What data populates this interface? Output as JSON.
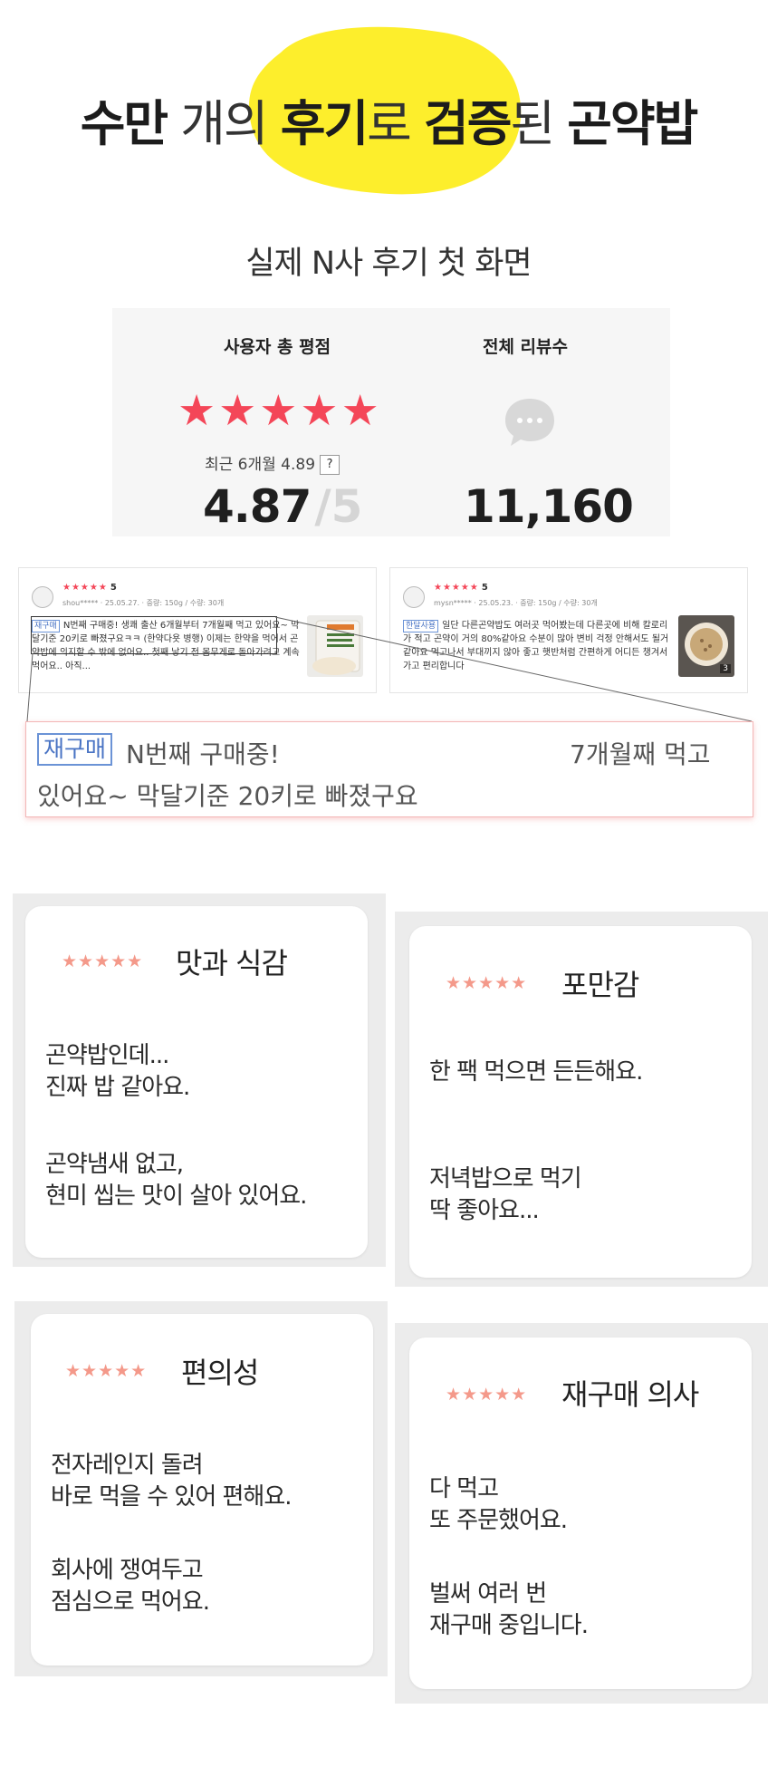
{
  "headline": {
    "part1": "수만",
    "part2": " 개의 ",
    "part3": "후기",
    "part4": "로 ",
    "part5": "검증",
    "part6": "된 ",
    "part7": "곤약밥"
  },
  "subtitle": "실제 N사 후기 첫 화면",
  "rating": {
    "title_left": "사용자 총 평점",
    "title_right": "전체 리뷰수",
    "stars": "★★★★★",
    "recent_label": "최근 6개월 4.89",
    "help_mark": "?",
    "score": "4.87",
    "score_max": "/5",
    "review_count": "11,160"
  },
  "reviews": [
    {
      "stars": "★★★★★",
      "rating": "5",
      "meta": "shou*****  · 25.05.27. · 중량: 150g / 수량: 30개",
      "tag": "재구매",
      "text": "N번째 구매중! 생쾌 출산 6개월부터 7개월째 먹고 있어요~ 막달기준 20키로 빠졌구요ㅋㅋ (한약다욧 병행) 이제는 한약을 먹어서 곤약밥에 의지할 수 밖에 없어요.. 첫째 낳기 전 몸무게로 돌아가려고 계속 먹어요.. 아직...",
      "photo_count": ""
    },
    {
      "stars": "★★★★★",
      "rating": "5",
      "meta": "mysn*****  · 25.05.23. · 중량: 150g / 수량: 30개",
      "tag": "한달사용",
      "text": "일단 다른곤약밥도 여러곳 먹어봤는데 다른곳에 비해 칼로리가 적고 곤약이 거의 80%같아요 수분이 많아 변비 걱정 안해서도 될거같아요 먹고나서 부대끼지 않아 좋고 햇반처럼 간편하게 어디든 챙겨서 가고 편리합니다",
      "photo_count": "3"
    }
  ],
  "zoom": {
    "tag": "재구매",
    "line1a": "N번째 구매중!",
    "line1b": "7개월째 먹고",
    "line2": "있어요~ 막달기준 20키로 빠졌구요"
  },
  "features": [
    {
      "stars": "★★★★★",
      "title": "맛과 식감",
      "p1a": "곤약밥인데...",
      "p1b": "진짜 밥 같아요.",
      "p2a": "곤약냄새 없고,",
      "p2b": "현미 씹는 맛이 살아 있어요."
    },
    {
      "stars": "★★★★★",
      "title": "포만감",
      "p1a": "한 팩 먹으면 든든해요.",
      "p1b": "",
      "p2a": "저녁밥으로 먹기",
      "p2b": "딱 좋아요..."
    },
    {
      "stars": "★★★★★",
      "title": "편의성",
      "p1a": "전자레인지 돌려",
      "p1b": "바로 먹을 수 있어 편해요.",
      "p2a": "회사에 쟁여두고",
      "p2b": "점심으로 먹어요."
    },
    {
      "stars": "★★★★★",
      "title": "재구매 의사",
      "p1a": "다 먹고",
      "p1b": "또 주문했어요.",
      "p2a": "벌써 여러 번",
      "p2b": "재구매 중입니다."
    }
  ],
  "colors": {
    "highlight_yellow": "#fdee2c",
    "rating_star_red": "#f44658",
    "feature_star_salmon": "#f4998a",
    "tag_blue": "#4a74c4"
  }
}
